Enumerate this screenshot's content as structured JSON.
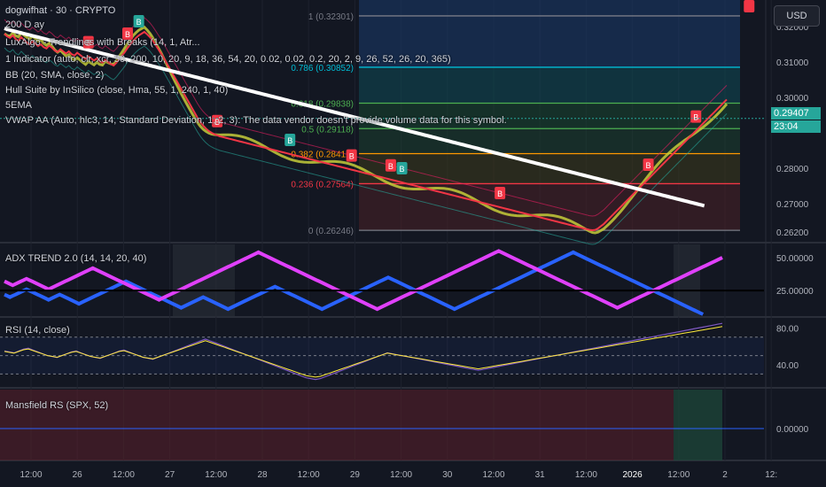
{
  "header": {
    "symbol": "dogwifhat · 30 · CRYPTO",
    "currency_button": "USD"
  },
  "indicators": {
    "main": [
      "200 D ay",
      "LuxAlgo - Trendlines with Breaks (14, 1, Atr...",
      "1 Indicator (auto, clr, xcr, 50, 200, 10, 20, 9, 18, 36, 54, 20, 0.02, 0.02, 0.2, 20, 2, 9, 26, 52, 26, 20, 365)",
      "BB (20, SMA, close, 2)",
      "Hull Suite by InSilico (close, Hma, 55, 1, 240, 1, 40)",
      "5EMA",
      "VWAP AA (Auto, hlc3, 14, Standard Deviation, 1, 2, 3): The data vendor doesn't provide volume data for this symbol."
    ],
    "adx": "ADX TREND 2.0 (14, 14, 20, 40)",
    "rsi": "RSI (14, close)",
    "mansfield": "Mansfield RS (SPX, 52)"
  },
  "price": {
    "last": "0.29407",
    "countdown": "23:04",
    "color_up": "#26a69a"
  },
  "chart_data": {
    "type": "line",
    "x_ticks": [
      "12:00",
      "26",
      "12:00",
      "27",
      "12:00",
      "28",
      "12:00",
      "29",
      "12:00",
      "30",
      "12:00",
      "31",
      "12:00",
      "2026",
      "12:00",
      "2",
      "12:"
    ],
    "main_pane": {
      "y_ticks": [
        "0.32000",
        "0.31000",
        "0.30000",
        "0.28000",
        "0.27000",
        "0.26200"
      ],
      "ylim": [
        0.26,
        0.326
      ],
      "fibonacci": [
        {
          "label": "1 (0.32301)",
          "value": 0.32301,
          "color": "#787b86"
        },
        {
          "label": "0.786 (0.30852)",
          "value": 0.30852,
          "color": "#00bcd4"
        },
        {
          "label": "0.618 (0.29838)",
          "value": 0.29838,
          "color": "#4caf50"
        },
        {
          "label": "0.5 (0.29118)",
          "value": 0.29118,
          "color": "#4caf50"
        },
        {
          "label": "0.382 (0.28412)",
          "value": 0.28412,
          "color": "#ff9800"
        },
        {
          "label": "0.236 (0.27564)",
          "value": 0.27564,
          "color": "#f23645"
        },
        {
          "label": "0 (0.26246)",
          "value": 0.26246,
          "color": "#787b86"
        }
      ],
      "signals": [
        {
          "type": "B",
          "i": 30,
          "color": "#f23645"
        },
        {
          "type": "B",
          "i": 44,
          "color": "#f23645"
        },
        {
          "type": "B",
          "i": 48,
          "color": "#26a69a"
        },
        {
          "type": "B",
          "i": 76,
          "color": "#f23645"
        },
        {
          "type": "B",
          "i": 102,
          "color": "#26a69a"
        },
        {
          "type": "B",
          "i": 124,
          "color": "#f23645"
        },
        {
          "type": "B",
          "i": 138,
          "color": "#f23645"
        },
        {
          "type": "B",
          "i": 142,
          "color": "#26a69a"
        },
        {
          "type": "B",
          "i": 177,
          "color": "#f23645"
        },
        {
          "type": "B",
          "i": 230,
          "color": "#f23645"
        },
        {
          "type": "B",
          "i": 247,
          "color": "#f23645"
        },
        {
          "type": "B",
          "i": 266,
          "color": "#f23645"
        },
        {
          "type": "B",
          "i": 307,
          "color": "#26a69a"
        }
      ],
      "close": [
        0.318,
        0.3172,
        0.3168,
        0.3175,
        0.3165,
        0.316,
        0.317,
        0.3162,
        0.3155,
        0.315,
        0.3158,
        0.3152,
        0.3145,
        0.315,
        0.3142,
        0.3138,
        0.3146,
        0.314,
        0.3132,
        0.3128,
        0.3136,
        0.313,
        0.3124,
        0.313,
        0.3122,
        0.3118,
        0.3126,
        0.312,
        0.3114,
        0.3108,
        0.3116,
        0.311,
        0.3104,
        0.311,
        0.3102,
        0.3098,
        0.3106,
        0.31,
        0.3094,
        0.309,
        0.3098,
        0.3108,
        0.3118,
        0.3128,
        0.314,
        0.315,
        0.316,
        0.3168,
        0.3175,
        0.318,
        0.3185,
        0.3178,
        0.317,
        0.316,
        0.3148,
        0.3136,
        0.3124,
        0.311,
        0.3096,
        0.3082,
        0.3068,
        0.3054,
        0.304,
        0.3026,
        0.3012,
        0.2998,
        0.2984,
        0.297,
        0.2956,
        0.2942,
        0.293,
        0.292,
        0.2912,
        0.2905,
        0.29,
        0.2896,
        0.2893,
        0.289,
        0.2888,
        0.2886,
        0.2884,
        0.2882,
        0.288,
        0.2878,
        0.2876,
        0.2874,
        0.2872,
        0.287,
        0.2868,
        0.2866,
        0.2864,
        0.2862,
        0.286,
        0.2858,
        0.2856,
        0.2854,
        0.2852,
        0.285,
        0.2848,
        0.2846,
        0.2844,
        0.2842,
        0.284,
        0.2838,
        0.2836,
        0.2834,
        0.2832,
        0.283,
        0.2828,
        0.2826,
        0.2824,
        0.2822,
        0.282,
        0.2818,
        0.2816,
        0.2814,
        0.2812,
        0.281,
        0.2808,
        0.2806,
        0.2804,
        0.2802,
        0.28,
        0.2798,
        0.2796,
        0.2794,
        0.2792,
        0.279,
        0.2788,
        0.2786,
        0.2784,
        0.2782,
        0.278,
        0.2778,
        0.2776,
        0.2774,
        0.2772,
        0.277,
        0.2768,
        0.2766,
        0.2764,
        0.2762,
        0.276,
        0.2758,
        0.2756,
        0.2754,
        0.2752,
        0.275,
        0.2748,
        0.2746,
        0.2744,
        0.2742,
        0.274,
        0.2738,
        0.2736,
        0.2734,
        0.2732,
        0.273,
        0.2728,
        0.2726,
        0.2724,
        0.2722,
        0.272,
        0.2718,
        0.2716,
        0.2714,
        0.2712,
        0.271,
        0.2708,
        0.2706,
        0.2704,
        0.2702,
        0.27,
        0.2698,
        0.2696,
        0.2694,
        0.2692,
        0.269,
        0.2688,
        0.2686,
        0.2684,
        0.2682,
        0.268,
        0.2678,
        0.2676,
        0.2674,
        0.2672,
        0.267,
        0.2668,
        0.2666,
        0.2664,
        0.2662,
        0.266,
        0.2658,
        0.2656,
        0.2654,
        0.2652,
        0.265,
        0.2648,
        0.2646,
        0.2644,
        0.2642,
        0.264,
        0.2638,
        0.2636,
        0.2634,
        0.2632,
        0.263,
        0.2628,
        0.2626,
        0.2625,
        0.2626,
        0.263,
        0.2636,
        0.2642,
        0.265,
        0.2658,
        0.2666,
        0.2674,
        0.2682,
        0.269,
        0.2698,
        0.2706,
        0.2714,
        0.2722,
        0.273,
        0.2738,
        0.2746,
        0.2754,
        0.2762,
        0.277,
        0.2778,
        0.2786,
        0.2794,
        0.2802,
        0.281,
        0.2818,
        0.2826,
        0.2834,
        0.2842,
        0.285,
        0.2858,
        0.2866,
        0.2874,
        0.2882,
        0.289,
        0.2898,
        0.2906,
        0.2914,
        0.2922,
        0.293,
        0.2938,
        0.2946,
        0.2954,
        0.2962,
        0.297,
        0.2978,
        0.2986,
        0.2994
      ],
      "ma_white": [
        0.3195,
        0.3192,
        0.319,
        0.3188,
        0.3186,
        0.3184,
        0.3182,
        0.318,
        0.3178,
        0.3176,
        0.3174,
        0.3172,
        0.317,
        0.3168,
        0.3166,
        0.3164,
        0.3162,
        0.316,
        0.3158,
        0.3156,
        0.3154,
        0.3152,
        0.315,
        0.3148,
        0.3146,
        0.3144,
        0.3142,
        0.314,
        0.3138,
        0.3136,
        0.3134,
        0.3132,
        0.313,
        0.3128,
        0.3126,
        0.3124,
        0.3122,
        0.312,
        0.3118,
        0.3116,
        0.3114,
        0.3112,
        0.311,
        0.3108,
        0.3106,
        0.3104,
        0.3102,
        0.31,
        0.3098,
        0.3096,
        0.3094,
        0.3092,
        0.309,
        0.3088,
        0.3086,
        0.3084,
        0.3082,
        0.308,
        0.3078,
        0.3076,
        0.3074,
        0.3072,
        0.307,
        0.3068,
        0.3066,
        0.3064,
        0.3062,
        0.306,
        0.3058,
        0.3056,
        0.3054,
        0.3052,
        0.305,
        0.3048,
        0.3046,
        0.3044,
        0.3042,
        0.304,
        0.3038,
        0.3036,
        0.3034,
        0.3032,
        0.303,
        0.3028,
        0.3026,
        0.3024,
        0.3022,
        0.302,
        0.3018,
        0.3016,
        0.3014,
        0.3012,
        0.301,
        0.3008,
        0.3006,
        0.3004,
        0.3002,
        0.3,
        0.2998,
        0.2996,
        0.2994,
        0.2992,
        0.299,
        0.2988,
        0.2986,
        0.2984,
        0.2982,
        0.298,
        0.2978,
        0.2976,
        0.2974,
        0.2972,
        0.297,
        0.2968,
        0.2966,
        0.2964,
        0.2962,
        0.296,
        0.2958,
        0.2956,
        0.2954,
        0.2952,
        0.295,
        0.2948,
        0.2946,
        0.2944,
        0.2942,
        0.294,
        0.2938,
        0.2936,
        0.2934,
        0.2932,
        0.293,
        0.2928,
        0.2926,
        0.2924,
        0.2922,
        0.292,
        0.2918,
        0.2916,
        0.2914,
        0.2912,
        0.291,
        0.2908,
        0.2906,
        0.2904,
        0.2902,
        0.29,
        0.2898,
        0.2896,
        0.2894,
        0.2892,
        0.289,
        0.2888,
        0.2886,
        0.2884,
        0.2882,
        0.288,
        0.2878,
        0.2876,
        0.2874,
        0.2872,
        0.287,
        0.2868,
        0.2866,
        0.2864,
        0.2862,
        0.286,
        0.2858,
        0.2856,
        0.2854,
        0.2852,
        0.285,
        0.2848,
        0.2846,
        0.2844,
        0.2842,
        0.284,
        0.2838,
        0.2836,
        0.2834,
        0.2832,
        0.283,
        0.2828,
        0.2826,
        0.2824,
        0.2822,
        0.282,
        0.2818,
        0.2816,
        0.2814,
        0.2812,
        0.281,
        0.2808,
        0.2806,
        0.2804,
        0.2802,
        0.28,
        0.2798,
        0.2796,
        0.2794,
        0.2792,
        0.279,
        0.2788,
        0.2786,
        0.2784,
        0.2782,
        0.278,
        0.2778,
        0.2776,
        0.2774,
        0.2772,
        0.277,
        0.2768,
        0.2766,
        0.2764,
        0.2762,
        0.276,
        0.2758,
        0.2756,
        0.2754,
        0.2752,
        0.275,
        0.2748,
        0.2746,
        0.2744,
        0.2742,
        0.274,
        0.2738,
        0.2736,
        0.2734,
        0.2732,
        0.273,
        0.2728,
        0.2726,
        0.2724,
        0.2722,
        0.272,
        0.2718,
        0.2716,
        0.2714,
        0.2712,
        0.271,
        0.2708,
        0.2706,
        0.2704,
        0.2702,
        0.27,
        0.2698,
        0.2696,
        0.2694
      ]
    },
    "adx_pane": {
      "y_ticks": [
        "50.00000",
        "25.00000"
      ],
      "ylim": [
        5,
        60
      ],
      "adx": [
        32,
        31,
        30,
        29,
        30,
        31,
        32,
        33,
        34,
        33,
        32,
        31,
        30,
        29,
        28,
        27,
        26,
        27,
        28,
        29,
        30,
        31,
        32,
        33,
        34,
        35,
        36,
        37,
        38,
        39,
        40,
        41,
        42,
        41,
        40,
        39,
        38,
        37,
        36,
        35,
        34,
        33,
        32,
        31,
        30,
        29,
        28,
        27,
        26,
        25,
        24,
        23,
        22,
        21,
        20,
        19,
        18,
        19,
        20,
        21,
        22,
        23,
        24,
        25,
        26,
        27,
        28,
        29,
        30,
        31,
        32,
        33,
        34,
        35,
        36,
        37,
        38,
        39,
        40,
        41,
        42,
        43,
        44,
        45,
        46,
        47,
        48,
        49,
        50,
        51,
        52,
        53,
        54,
        53,
        52,
        51,
        50,
        49,
        48,
        47,
        46,
        45,
        44,
        43,
        42,
        41,
        40,
        39,
        38,
        37,
        36,
        35,
        34,
        33,
        32,
        31,
        30,
        29,
        28,
        27,
        26,
        25,
        24,
        23,
        22,
        21,
        20,
        19,
        18,
        17,
        16,
        15,
        14,
        13,
        12,
        11,
        12,
        13,
        14,
        15,
        16,
        17,
        18,
        19,
        20,
        21,
        22,
        23,
        24,
        25,
        26,
        27,
        28,
        29,
        30,
        31,
        32,
        33,
        34,
        35,
        36,
        37,
        38,
        39,
        40,
        41,
        42,
        43,
        44,
        45,
        46,
        47,
        48,
        49,
        50,
        51,
        52,
        53,
        54,
        55,
        54,
        53,
        52,
        51,
        50,
        49,
        48,
        47,
        46,
        45,
        44,
        43,
        42,
        41,
        40,
        39,
        38,
        37,
        36,
        35,
        34,
        33,
        32,
        31,
        30,
        29,
        28,
        27,
        26,
        25,
        24,
        23,
        22,
        21,
        20,
        19,
        18,
        17,
        16,
        15,
        14,
        13,
        12,
        13,
        14,
        15,
        16,
        17,
        18,
        19,
        20,
        21,
        22,
        23,
        24,
        25,
        26,
        27,
        28,
        29,
        30,
        31,
        32,
        33,
        34,
        35,
        36,
        37,
        38,
        39,
        40,
        41,
        42,
        43,
        44,
        45,
        46,
        47,
        48,
        49,
        50
      ],
      "di_minus": [
        22,
        21,
        20,
        21,
        22,
        23,
        24,
        25,
        26,
        25,
        24,
        23,
        22,
        21,
        20,
        19,
        18,
        19,
        20,
        21,
        22,
        21,
        20,
        19,
        18,
        17,
        16,
        15,
        16,
        17,
        18,
        19,
        20,
        21,
        22,
        23,
        24,
        25,
        26,
        27,
        28,
        29,
        30,
        31,
        32,
        31,
        30,
        29,
        28,
        27,
        26,
        25,
        24,
        23,
        22,
        21,
        20,
        19,
        18,
        17,
        16,
        15,
        14,
        13,
        12,
        13,
        14,
        15,
        16,
        17,
        18,
        19,
        20,
        19,
        18,
        17,
        16,
        15,
        14,
        13,
        12,
        11,
        12,
        13,
        14,
        15,
        16,
        17,
        18,
        19,
        20,
        21,
        22,
        23,
        24,
        25,
        26,
        27,
        28,
        27,
        26,
        25,
        24,
        23,
        22,
        21,
        20,
        19,
        18,
        17,
        16,
        15,
        14,
        13,
        12,
        11,
        12,
        13,
        14,
        15,
        16,
        17,
        18,
        19,
        20,
        21,
        22,
        23,
        24,
        25,
        26,
        27,
        28,
        29,
        30,
        31,
        32,
        33,
        34,
        35,
        34,
        33,
        32,
        31,
        30,
        29,
        28,
        27,
        26,
        25,
        24,
        23,
        22,
        21,
        20,
        19,
        18,
        17,
        16,
        15,
        14,
        13,
        12,
        11,
        12,
        13,
        14,
        15,
        16,
        17,
        18,
        19,
        20,
        21,
        22,
        23,
        24,
        25,
        26,
        27,
        28,
        29,
        30,
        31,
        32,
        33,
        34,
        35,
        36,
        37,
        38,
        39,
        40,
        41,
        42,
        43,
        44,
        45,
        46,
        47,
        48,
        49,
        50,
        51,
        52,
        53,
        54,
        53,
        52,
        51,
        50,
        49,
        48,
        47,
        46,
        45,
        44,
        43,
        42,
        41,
        40,
        39,
        38,
        37,
        36,
        35,
        34,
        33,
        32,
        31,
        30,
        29,
        28,
        27,
        26,
        25,
        24,
        23,
        22,
        21,
        20,
        19,
        18,
        17,
        16,
        15,
        14,
        13,
        12,
        11,
        10,
        9,
        8,
        7
      ]
    },
    "rsi_pane": {
      "y_ticks": [
        "80.00",
        "40.00"
      ],
      "ylim": [
        15,
        90
      ],
      "rsi": [
        55,
        54,
        53,
        55,
        57,
        58,
        56,
        54,
        52,
        50,
        49,
        48,
        50,
        52,
        54,
        55,
        53,
        51,
        49,
        48,
        47,
        49,
        51,
        53,
        55,
        56,
        54,
        52,
        50,
        48,
        47,
        46,
        48,
        50,
        52,
        54,
        56,
        58,
        60,
        62,
        64,
        66,
        68,
        66,
        64,
        62,
        60,
        58,
        56,
        54,
        52,
        50,
        48,
        46,
        44,
        42,
        40,
        38,
        36,
        34,
        32,
        30,
        28,
        26,
        25,
        24,
        25,
        27,
        29,
        31,
        33,
        35,
        37,
        39,
        41,
        43,
        45,
        47,
        49,
        51,
        53,
        52,
        51,
        50,
        49,
        48,
        47,
        46,
        45,
        44,
        43,
        42,
        41,
        40,
        39,
        38,
        37,
        36,
        35,
        34,
        35,
        36,
        37,
        38,
        39,
        40,
        41,
        42,
        43,
        44,
        45,
        46,
        47,
        48,
        49,
        50,
        51,
        52,
        53,
        54,
        55,
        56,
        57,
        58,
        59,
        60,
        61,
        62,
        63,
        64,
        65,
        66,
        67,
        68,
        69,
        70,
        71,
        72,
        73,
        74,
        75,
        76,
        77,
        78,
        79,
        80,
        81,
        82,
        83,
        84,
        85
      ]
    },
    "mansfield_pane": {
      "y_ticks": [
        "0.00000"
      ],
      "ylim": [
        -1,
        1
      ]
    }
  }
}
